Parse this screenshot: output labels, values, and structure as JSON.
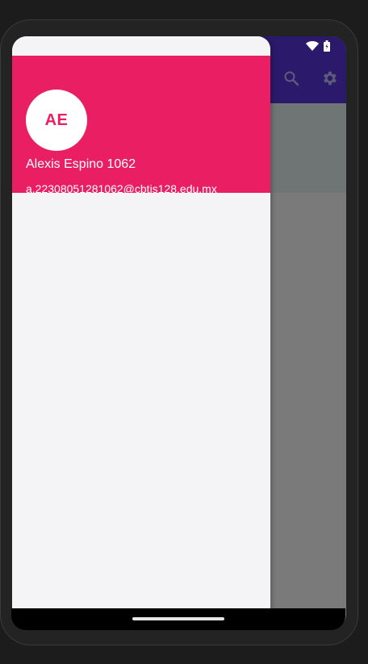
{
  "drawer": {
    "avatar_initials": "AE",
    "user_name": "Alexis Espino 1062",
    "user_email": "a.22308051281062@cbtis128.edu.mx"
  },
  "app_toolbar": {
    "actions": [
      {
        "icon": "search-icon"
      },
      {
        "icon": "gear-icon"
      }
    ]
  },
  "status_bar": {
    "icons": [
      "wifi-icon",
      "battery-icon"
    ]
  },
  "colors": {
    "drawer_header": "#ea1e63",
    "toolbar": "#2b1a6b",
    "scrim": "#7a7a7a",
    "drawer_bg": "#f4f3f6"
  }
}
